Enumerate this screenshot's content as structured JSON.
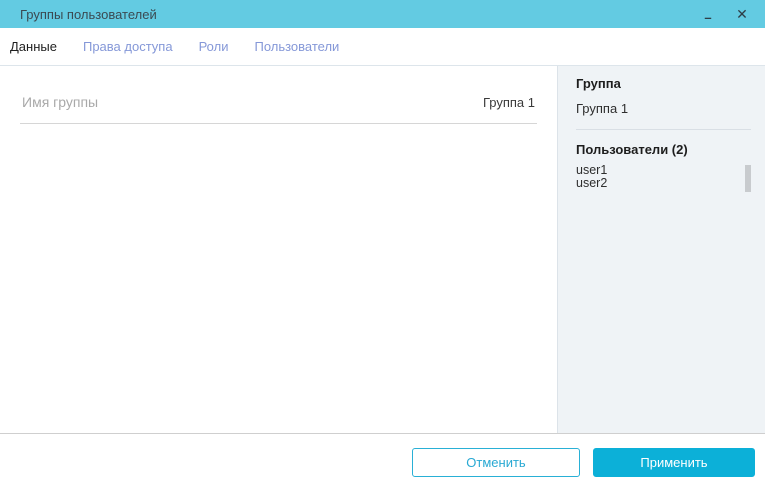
{
  "window": {
    "title": "Группы пользователей",
    "controls": {
      "minimize": "–",
      "close": "✕"
    }
  },
  "tabs": [
    {
      "label": "Данные",
      "active": true
    },
    {
      "label": "Права доступа",
      "active": false
    },
    {
      "label": "Роли",
      "active": false
    },
    {
      "label": "Пользователи",
      "active": false
    }
  ],
  "form": {
    "group_name": {
      "placeholder": "Имя группы",
      "value": "Группа 1"
    }
  },
  "summary_panel": {
    "group_header": "Группа",
    "group_value": "Группа 1",
    "users_header": "Пользователи (2)",
    "users": [
      "user1",
      "user2"
    ]
  },
  "footer": {
    "cancel_label": "Отменить",
    "apply_label": "Применить"
  },
  "colors": {
    "titlebar": "#63cbe2",
    "titlebar_text": "#3b4a52",
    "accent": "#0cb0d8",
    "accent_text": "#ffffff",
    "tab_active": "#1f1f1f",
    "tab_inactive": "#8598d8",
    "panel_bg": "#eff3f6"
  }
}
